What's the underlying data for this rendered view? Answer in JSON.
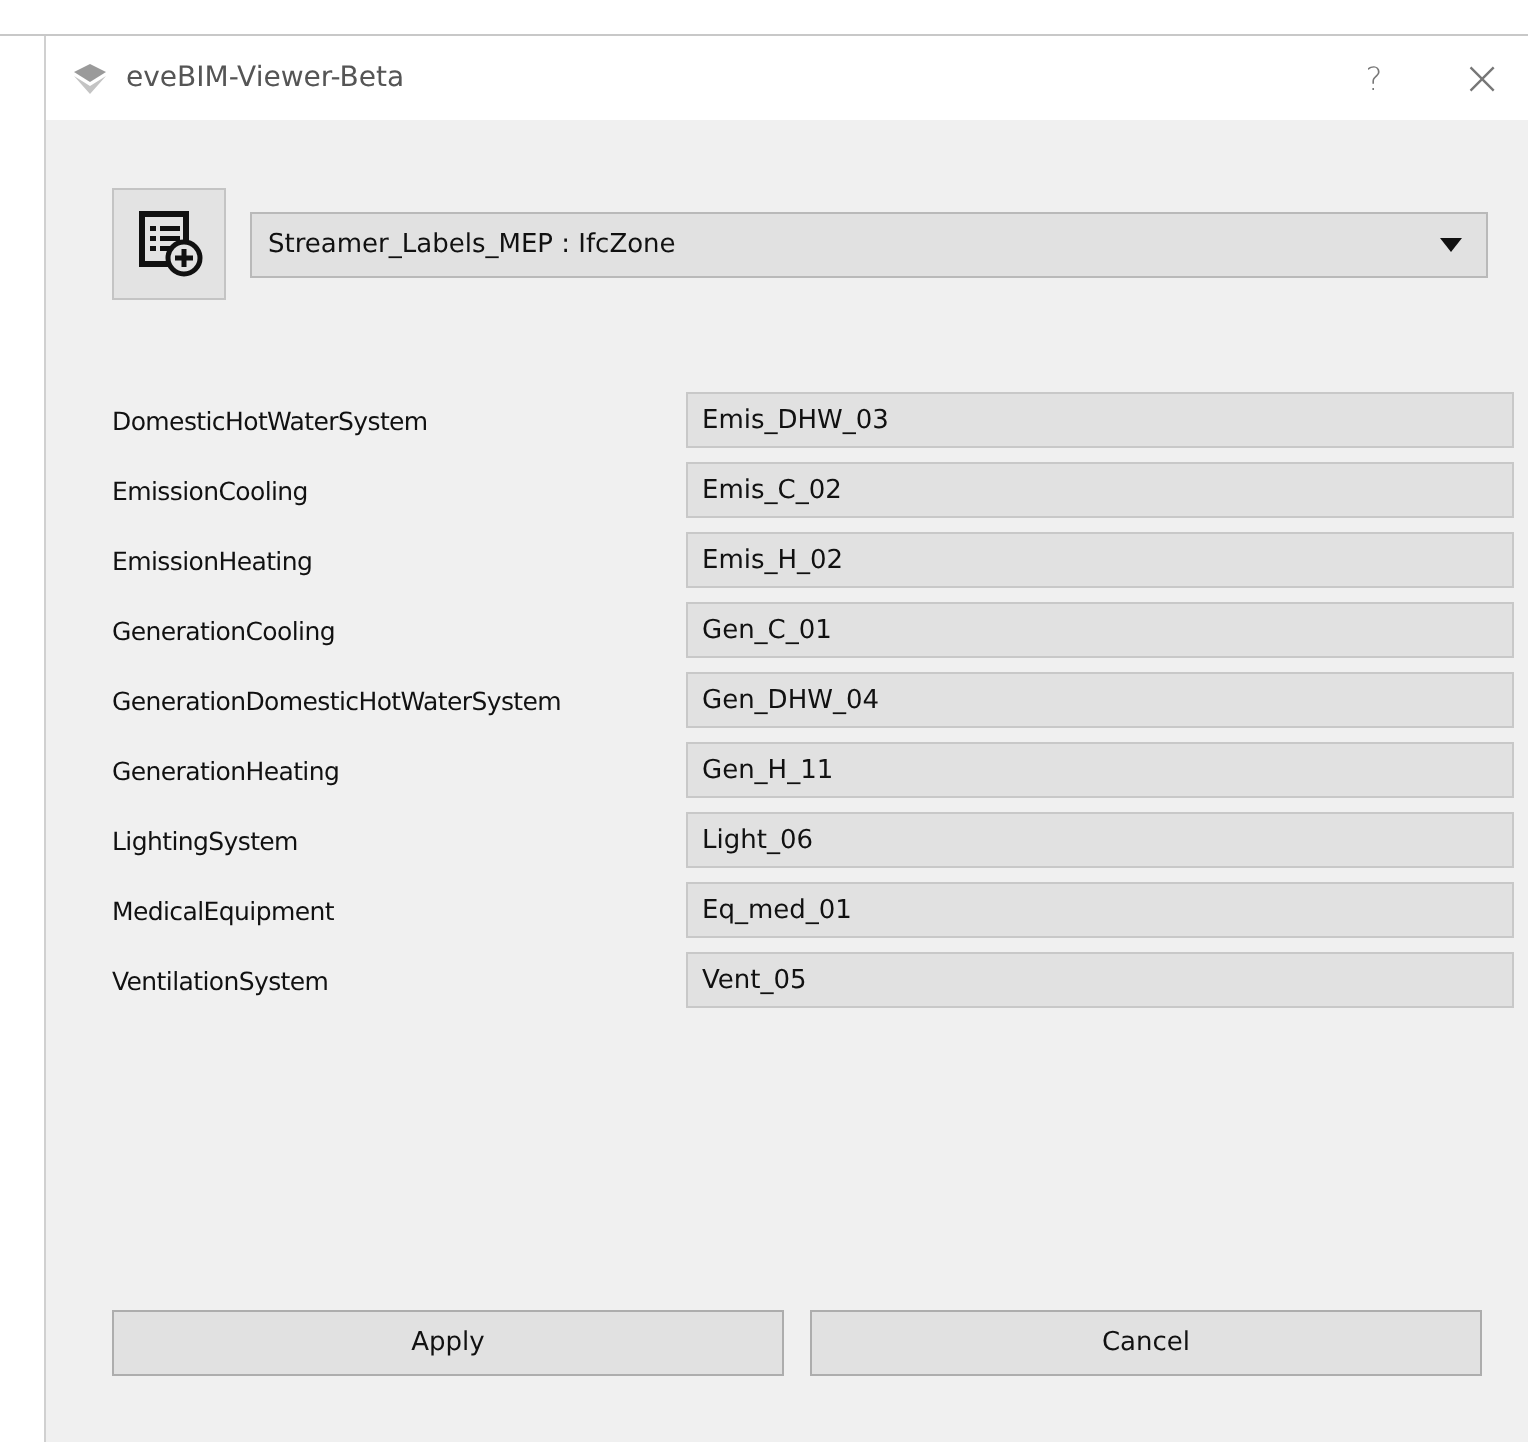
{
  "window": {
    "title": "eveBIM-Viewer-Beta",
    "help": "?",
    "close": "×"
  },
  "selector": {
    "value": "Streamer_Labels_MEP : IfcZone"
  },
  "properties": [
    {
      "label": "DomesticHotWaterSystem",
      "value": "Emis_DHW_03"
    },
    {
      "label": "EmissionCooling",
      "value": "Emis_C_02"
    },
    {
      "label": "EmissionHeating",
      "value": "Emis_H_02"
    },
    {
      "label": "GenerationCooling",
      "value": "Gen_C_01"
    },
    {
      "label": "GenerationDomesticHotWaterSystem",
      "value": "Gen_DHW_04"
    },
    {
      "label": "GenerationHeating",
      "value": "Gen_H_11"
    },
    {
      "label": "LightingSystem",
      "value": "Light_06"
    },
    {
      "label": "MedicalEquipment",
      "value": "Eq_med_01"
    },
    {
      "label": "VentilationSystem",
      "value": "Vent_05"
    }
  ],
  "buttons": [
    "Apply",
    "Cancel"
  ]
}
